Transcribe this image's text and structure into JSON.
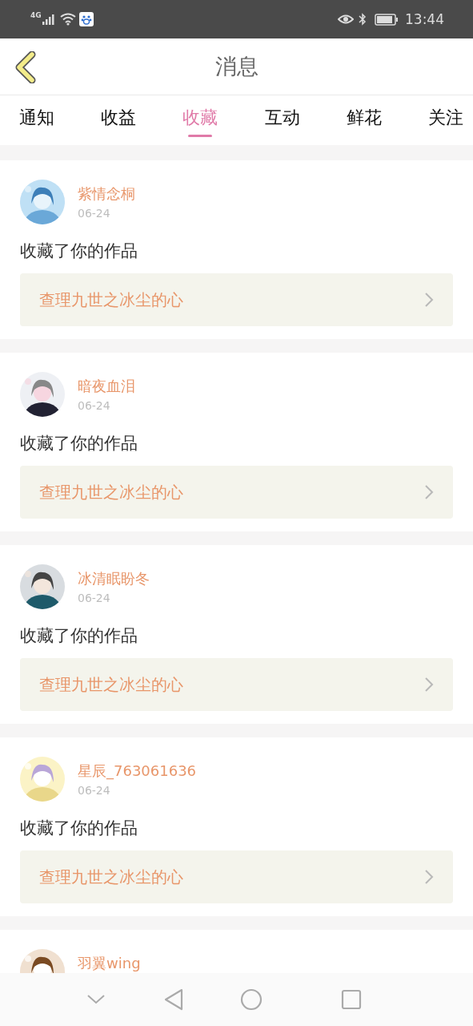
{
  "status_bar": {
    "network": "4G",
    "time": "13:44"
  },
  "header": {
    "title": "消息"
  },
  "tabs": [
    {
      "label": "通知",
      "selected": false
    },
    {
      "label": "收益",
      "selected": false
    },
    {
      "label": "收藏",
      "selected": true
    },
    {
      "label": "互动",
      "selected": false
    },
    {
      "label": "鲜花",
      "selected": false
    },
    {
      "label": "关注",
      "selected": false
    }
  ],
  "messages": [
    {
      "user": "紫情念桐",
      "date": "06-24",
      "action": "收藏了你的作品",
      "work": "查理九世之冰尘的心"
    },
    {
      "user": "暗夜血泪",
      "date": "06-24",
      "action": "收藏了你的作品",
      "work": "查理九世之冰尘的心"
    },
    {
      "user": "冰清眠盼冬",
      "date": "06-24",
      "action": "收藏了你的作品",
      "work": "查理九世之冰尘的心"
    },
    {
      "user": "星辰_763061636",
      "date": "06-24",
      "action": "收藏了你的作品",
      "work": "查理九世之冰尘的心"
    },
    {
      "user": "羽翼wing"
    }
  ]
}
